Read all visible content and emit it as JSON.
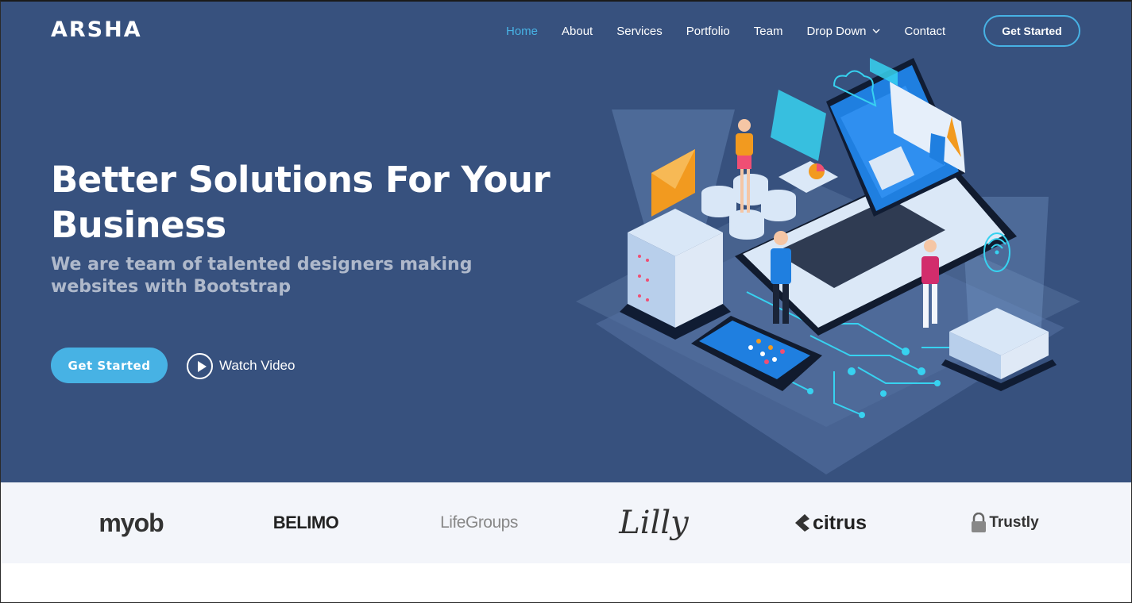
{
  "header": {
    "logo": "ARSHA",
    "nav": [
      {
        "label": "Home",
        "active": true
      },
      {
        "label": "About"
      },
      {
        "label": "Services"
      },
      {
        "label": "Portfolio"
      },
      {
        "label": "Team"
      },
      {
        "label": "Drop Down",
        "has_dropdown": true
      },
      {
        "label": "Contact"
      }
    ],
    "cta_label": "Get Started"
  },
  "hero": {
    "title": "Better Solutions For Your Business",
    "subtitle": "We are team of talented designers making websites with Bootstrap",
    "primary_button": "Get Started",
    "video_button": "Watch Video",
    "illustration_icon": "isometric-tech-illustration"
  },
  "clients": [
    {
      "name": "myob"
    },
    {
      "name": "BELIMO"
    },
    {
      "name": "LifeGroups"
    },
    {
      "name": "Lilly"
    },
    {
      "name": "citrus"
    },
    {
      "name": "Trustly"
    }
  ],
  "colors": {
    "hero_bg": "#37517e",
    "accent": "#47b2e4",
    "clients_bg": "#f3f5fa"
  }
}
